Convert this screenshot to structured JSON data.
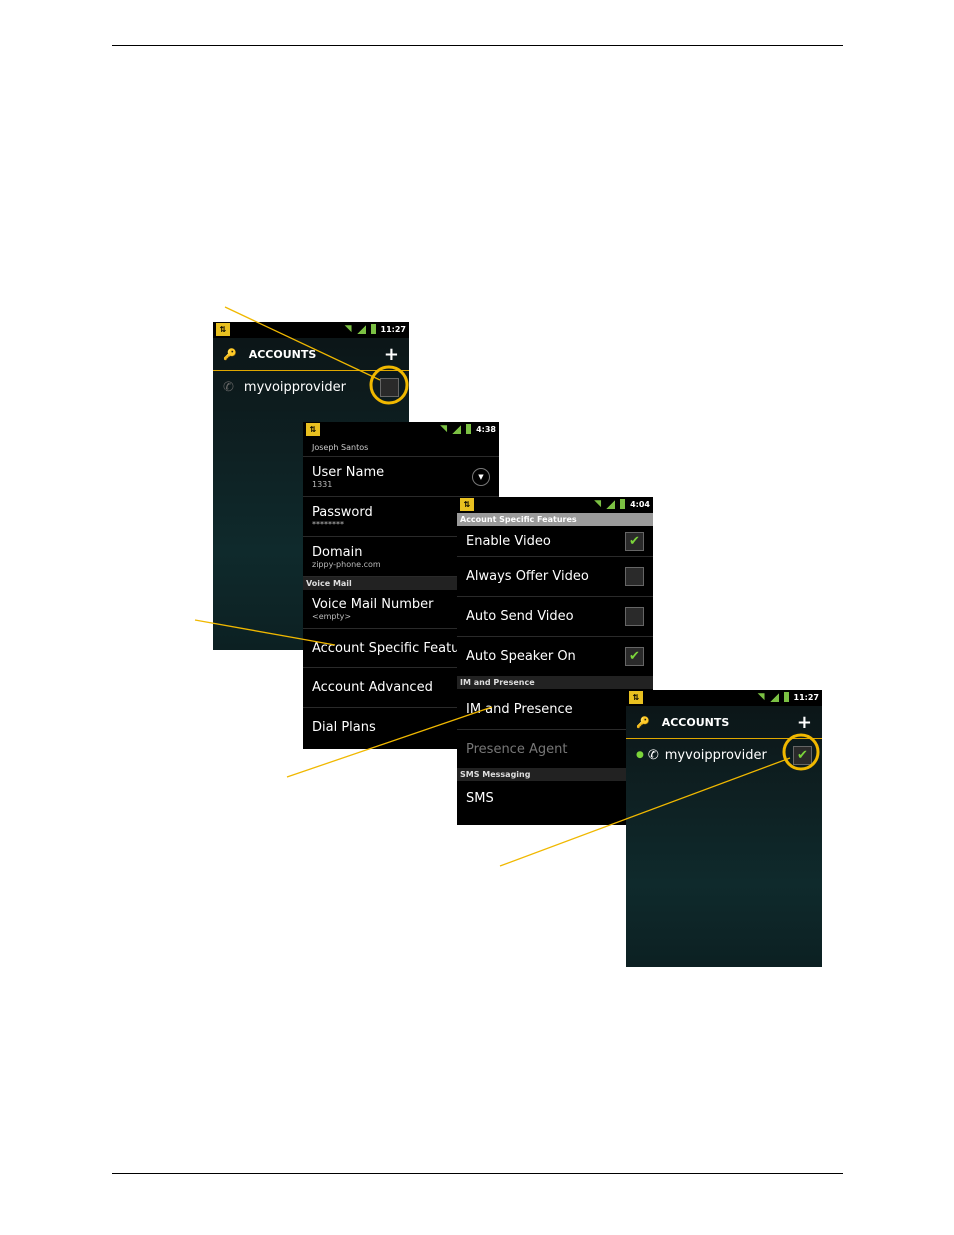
{
  "accent": "#f0b800",
  "screen1": {
    "time": "11:27",
    "title": "ACCOUNTS",
    "add": "+",
    "account": "myvoipprovider",
    "checked": false
  },
  "screen2": {
    "time": "4:38",
    "header": "Joseph Santos",
    "rows": [
      {
        "title": "User Name",
        "sub": "1331"
      },
      {
        "title": "Password",
        "sub": "********"
      },
      {
        "title": "Domain",
        "sub": "zippy-phone.com"
      }
    ],
    "section": "Voice Mail",
    "rows2": [
      {
        "title": "Voice Mail Number",
        "sub": "<empty>"
      },
      {
        "title": "Account Specific Features"
      },
      {
        "title": "Account Advanced"
      },
      {
        "title": "Dial Plans"
      }
    ]
  },
  "screen3": {
    "time": "4:04",
    "section1": "Account Specific Features",
    "items": [
      {
        "label": "Enable Video",
        "checked": true
      },
      {
        "label": "Always Offer Video",
        "checked": false
      },
      {
        "label": "Auto Send Video",
        "checked": false
      },
      {
        "label": "Auto Speaker On",
        "checked": true
      }
    ],
    "section2": "IM and Presence",
    "im": "IM and Presence",
    "presence": "Presence Agent",
    "section3": "SMS Messaging",
    "sms": "SMS"
  },
  "screen4": {
    "time": "11:27",
    "title": "ACCOUNTS",
    "add": "+",
    "account": "myvoipprovider",
    "checked": true
  }
}
